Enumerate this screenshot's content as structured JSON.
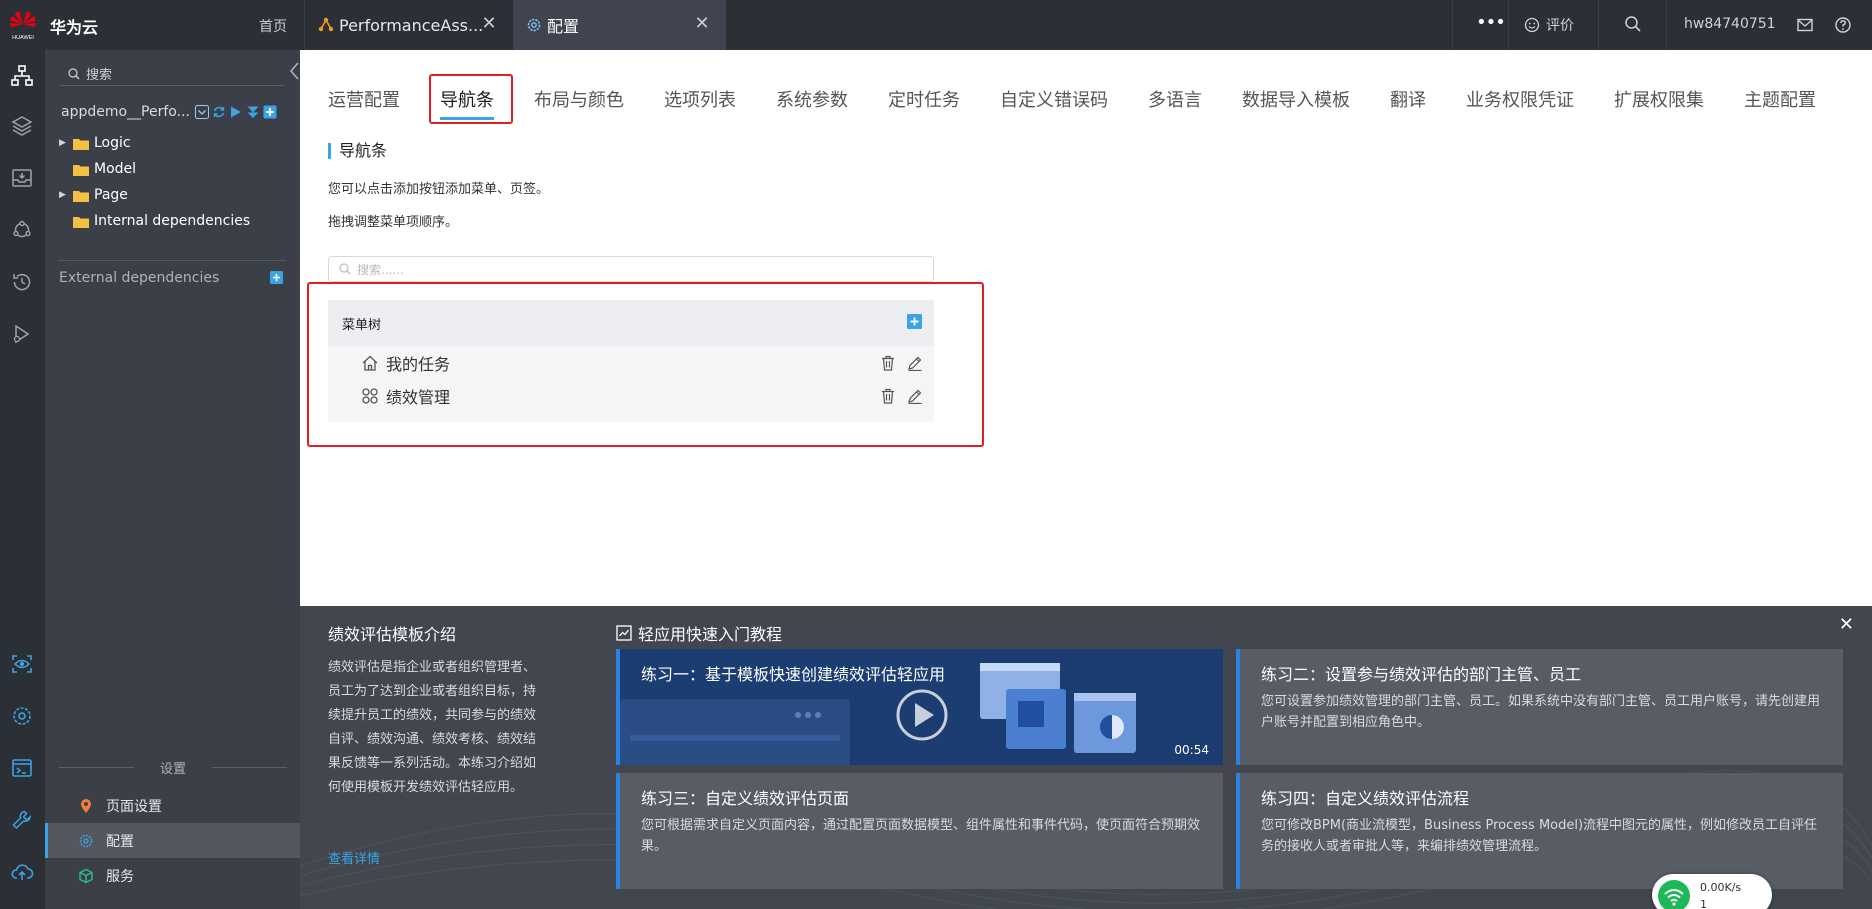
{
  "topbar": {
    "brand": "华为云",
    "logo_text": "HUAWEI",
    "home": "首页",
    "tabs": [
      {
        "label": "PerformanceAss...",
        "icon": "app-icon"
      },
      {
        "label": "配置",
        "icon": "gear-icon"
      }
    ],
    "rate_label": "评价",
    "username": "hw84740751"
  },
  "explorer": {
    "search_placeholder": "搜索",
    "project": "appdemo__Perfo...",
    "tree": [
      {
        "label": "Logic",
        "expandable": true
      },
      {
        "label": "Model",
        "expandable": false
      },
      {
        "label": "Page",
        "expandable": true
      },
      {
        "label": "Internal dependencies",
        "expandable": false
      }
    ],
    "external_dependencies": "External dependencies",
    "settings_header": "设置",
    "settings_items": [
      {
        "label": "页面设置",
        "icon": "location-icon",
        "active": false
      },
      {
        "label": "配置",
        "icon": "gear-icon",
        "active": true
      },
      {
        "label": "服务",
        "icon": "cube-icon",
        "active": false
      }
    ]
  },
  "main": {
    "config_tabs": [
      "运营配置",
      "导航条",
      "布局与颜色",
      "选项列表",
      "系统参数",
      "定时任务",
      "自定义错误码",
      "多语言",
      "数据导入模板",
      "翻译",
      "业务权限凭证",
      "扩展权限集",
      "主题配置"
    ],
    "active_tab": "导航条",
    "section_title": "导航条",
    "desc1": "您可以点击添加按钮添加菜单、页签。",
    "desc2": "拖拽调整菜单项顺序。",
    "search_placeholder": "搜索......",
    "menu_tree": {
      "header": "菜单树",
      "items": [
        {
          "label": "我的任务",
          "icon": "home-icon"
        },
        {
          "label": "绩效管理",
          "icon": "apps-icon"
        }
      ]
    }
  },
  "tutorial": {
    "intro_title": "绩效评估模板介绍",
    "intro_body": "绩效评估是指企业或者组织管理者、员工为了达到企业或者组织目标，持续提升员工的绩效，共同参与的绩效自评、绩效沟通、绩效考核、绩效结果反馈等一系列活动。本练习介绍如何使用模板开发绩效评估轻应用。",
    "intro_more": "查看详情",
    "title": "轻应用快速入门教程",
    "lessons": [
      {
        "title": "练习一：基于模板快速创建绩效评估轻应用",
        "desc": "",
        "duration": "00:54"
      },
      {
        "title": "练习二：设置参与绩效评估的部门主管、员工",
        "desc": "您可设置参加绩效管理的部门主管、员工。如果系统中没有部门主管、员工用户账号，请先创建用户账号并配置到相应角色中。"
      },
      {
        "title": "练习三：自定义绩效评估页面",
        "desc": "您可根据需求自定义页面内容，通过配置页面数据模型、组件属性和事件代码，使页面符合预期效果。"
      },
      {
        "title": "练习四：自定义绩效评估流程",
        "desc": "您可修改BPM(商业流模型，Business Process Model)流程中图元的属性，例如修改员工自评任务的接收人或者审批人等，来编排绩效管理流程。"
      }
    ]
  },
  "network": {
    "speed": "0.00K/s",
    "count": "1"
  },
  "colors": {
    "accent": "#3aa4e4",
    "highlight": "#e02020",
    "topbar": "#2c2f36",
    "sidebar": "#3b3f47",
    "huawei_red": "#e60012"
  }
}
